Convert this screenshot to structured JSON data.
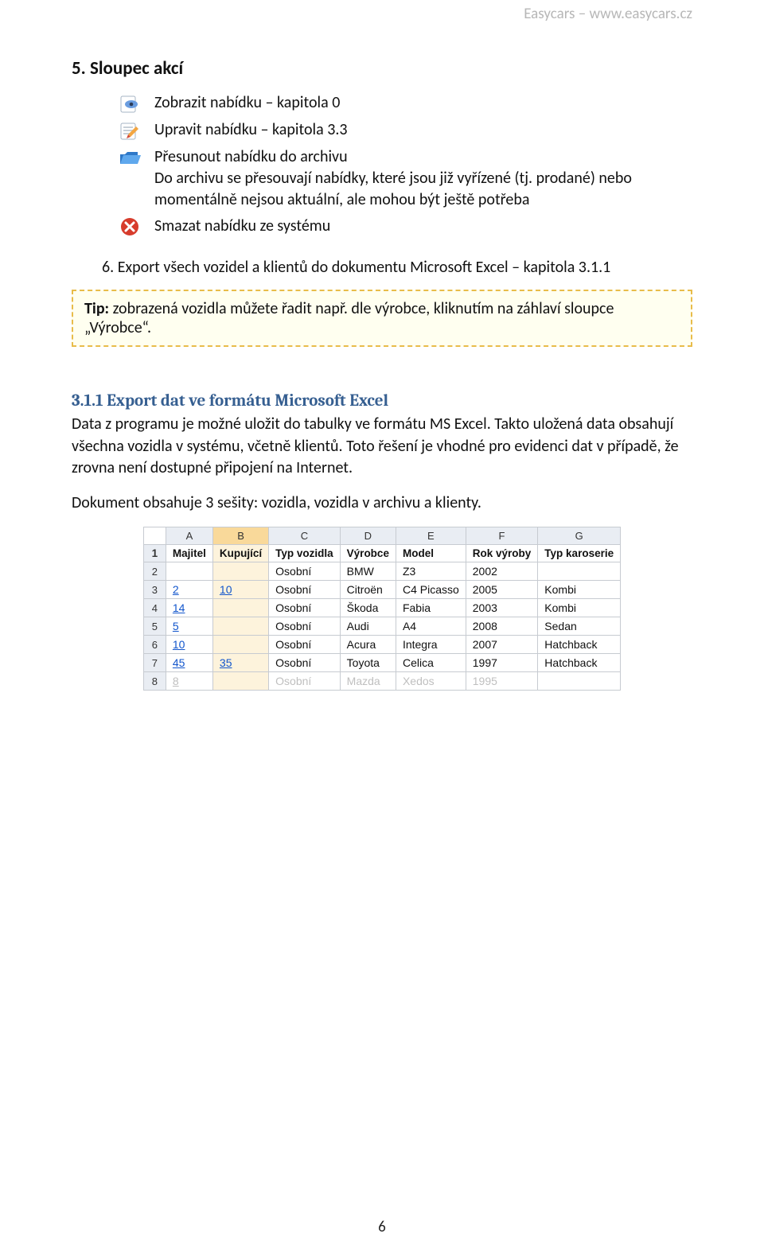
{
  "header": {
    "right": "Easycars – www.easycars.cz"
  },
  "section5": {
    "title": "5.   Sloupec akcí",
    "actions": [
      {
        "text": "Zobrazit nabídku – kapitola 0"
      },
      {
        "text": "Upravit nabídku – kapitola 3.3"
      },
      {
        "text_line1": "Přesunout nabídku do archivu",
        "text_line2": "Do archivu se přesouvají nabídky, které jsou již vyřízené (tj. prodané) nebo momentálně nejsou aktuální, ale mohou být ještě potřeba"
      },
      {
        "text": "Smazat nabídku ze systému"
      }
    ]
  },
  "item6": "6.   Export všech vozidel a klientů do dokumentu Microsoft Excel – kapitola 3.1.1",
  "tip": {
    "label": "Tip:",
    "text": " zobrazená vozidla můžete řadit např. dle výrobce, kliknutím na záhlaví sloupce „Výrobce“."
  },
  "sec311": {
    "heading": "3.1.1   Export dat ve formátu Microsoft Excel",
    "para1": "Data z programu je možné uložit do tabulky ve formátu MS Excel. Takto uložená data obsahují všechna vozidla v systému, včetně klientů. Toto řešení je vhodné pro evidenci dat v případě, že zrovna není dostupné připojení na Internet.",
    "para2": "Dokument obsahuje 3 sešity: vozidla, vozidla v archivu a klienty."
  },
  "excel": {
    "cols": [
      "A",
      "B",
      "C",
      "D",
      "E",
      "F",
      "G"
    ],
    "headers": [
      "Majitel",
      "Kupující",
      "Typ vozidla",
      "Výrobce",
      "Model",
      "Rok výroby",
      "Typ karoserie"
    ],
    "rows": [
      {
        "n": "2",
        "majitel": "",
        "kup": "",
        "typ": "Osobní",
        "vyr": "BMW",
        "model": "Z3",
        "rok": "2002",
        "kar": ""
      },
      {
        "n": "3",
        "majitel": "2",
        "kup": "10",
        "typ": "Osobní",
        "vyr": "Citroën",
        "model": "C4 Picasso",
        "rok": "2005",
        "kar": "Kombi"
      },
      {
        "n": "4",
        "majitel": "14",
        "kup": "",
        "typ": "Osobní",
        "vyr": "Škoda",
        "model": "Fabia",
        "rok": "2003",
        "kar": "Kombi"
      },
      {
        "n": "5",
        "majitel": "5",
        "kup": "",
        "typ": "Osobní",
        "vyr": "Audi",
        "model": "A4",
        "rok": "2008",
        "kar": "Sedan"
      },
      {
        "n": "6",
        "majitel": "10",
        "kup": "",
        "typ": "Osobní",
        "vyr": "Acura",
        "model": "Integra",
        "rok": "2007",
        "kar": "Hatchback"
      },
      {
        "n": "7",
        "majitel": "45",
        "kup": "35",
        "typ": "Osobní",
        "vyr": "Toyota",
        "model": "Celica",
        "rok": "1997",
        "kar": "Hatchback"
      },
      {
        "n": "8",
        "majitel": "8",
        "kup": "",
        "typ": "Osobní",
        "vyr": "Mazda",
        "model": "Xedos",
        "rok": "1995",
        "kar": ""
      }
    ]
  },
  "page": "6"
}
